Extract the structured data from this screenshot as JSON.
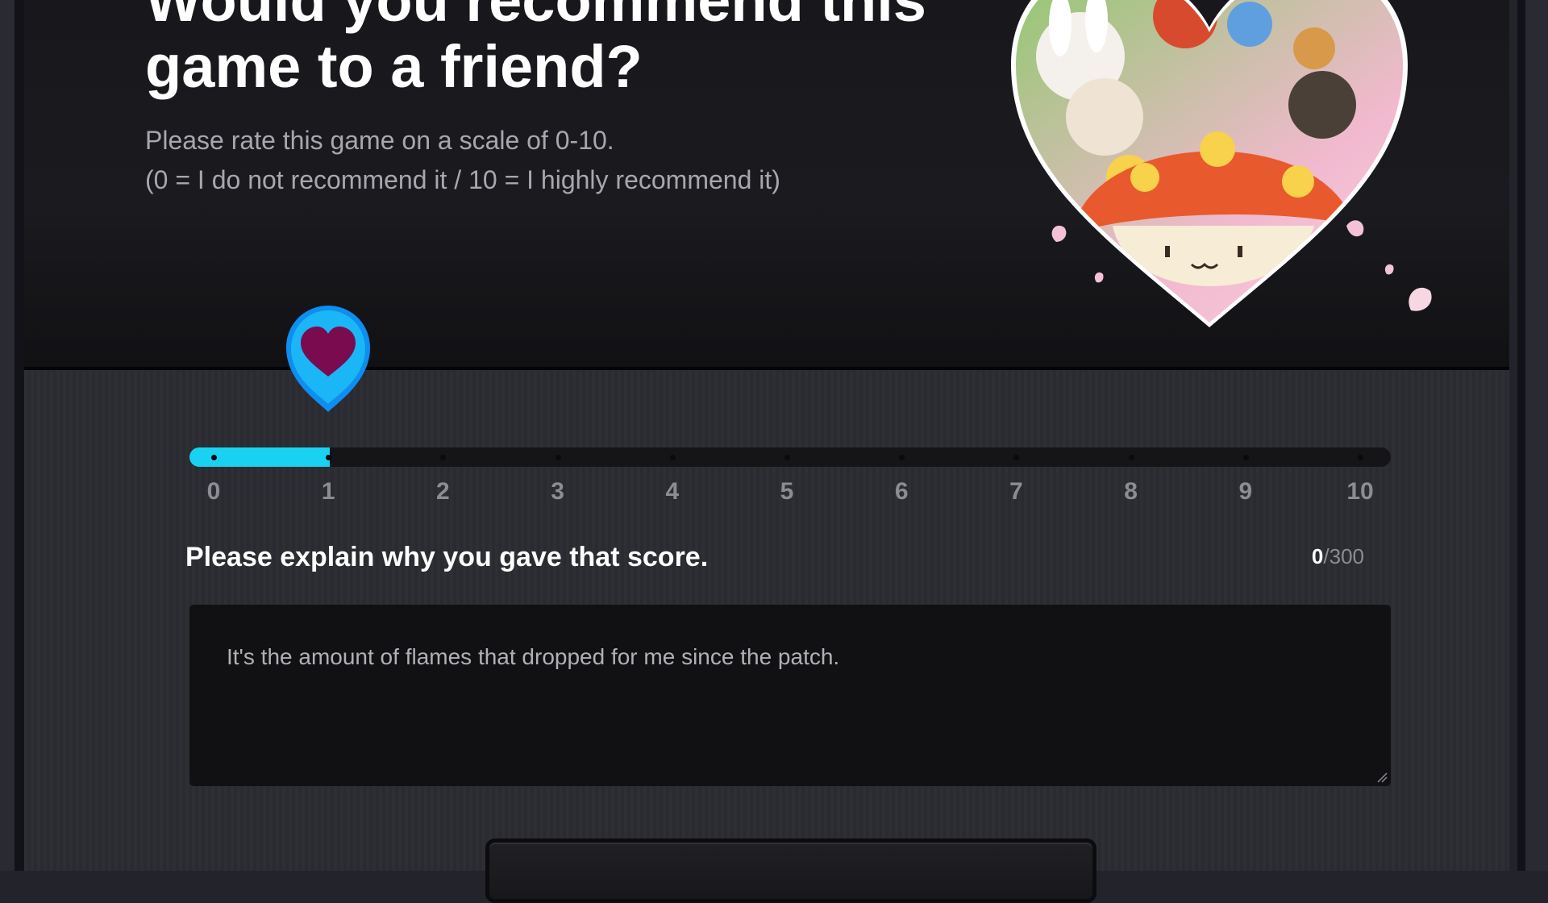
{
  "survey": {
    "title": "Would you recommend this game to a friend?",
    "subtitle_line1": "Please rate this game on a scale of 0-10.",
    "subtitle_line2": "(0 = I do not recommend it / 10 = I highly recommend it)"
  },
  "rating": {
    "min": 0,
    "max": 10,
    "value": 1,
    "ticks": [
      "0",
      "1",
      "2",
      "3",
      "4",
      "5",
      "6",
      "7",
      "8",
      "9",
      "10"
    ],
    "handle_icon": "heart-pin-icon"
  },
  "explanation": {
    "label": "Please explain why you gave that score.",
    "char_count": "0",
    "char_limit": "/300",
    "text": "It's the amount of flames that dropped for me since the patch."
  },
  "colors": {
    "accent": "#19d2f2",
    "heart": "#7a0b4e",
    "pin": "#0d8ef0"
  }
}
